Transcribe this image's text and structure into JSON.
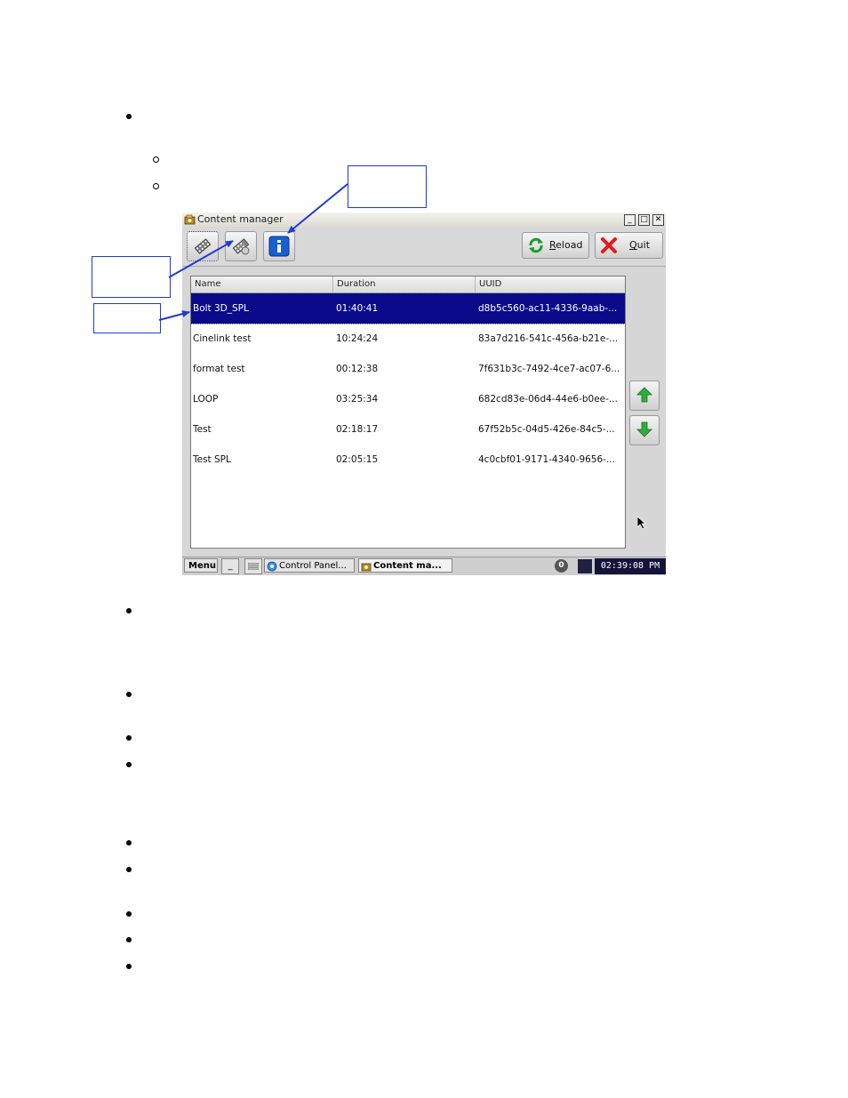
{
  "window": {
    "title": "Content manager",
    "minimize_glyph": "_",
    "maximize_glyph": "□",
    "close_glyph": "✕"
  },
  "toolbar": {
    "buttons": [
      {
        "icon": "ingest-film-icon",
        "active": true
      },
      {
        "icon": "delete-film-icon",
        "active": false
      },
      {
        "icon": "info-icon",
        "active": false
      }
    ],
    "reload_label": "Reload",
    "reload_mnemonic": "R",
    "reload_rest": "eload",
    "quit_label": "Quit",
    "quit_mnemonic": "Q",
    "quit_rest": "uit"
  },
  "table": {
    "columns": [
      "Name",
      "Duration",
      "UUID"
    ],
    "rows": [
      {
        "name": "Bolt 3D_SPL",
        "duration": "01:40:41",
        "uuid": "d8b5c560-ac11-4336-9aab-...",
        "selected": true
      },
      {
        "name": "Cinelink test",
        "duration": "10:24:24",
        "uuid": "83a7d216-541c-456a-b21e-...",
        "selected": false
      },
      {
        "name": "format test",
        "duration": "00:12:38",
        "uuid": "7f631b3c-7492-4ce7-ac07-6...",
        "selected": false
      },
      {
        "name": "LOOP",
        "duration": "03:25:34",
        "uuid": "682cd83e-06d4-44e6-b0ee-...",
        "selected": false
      },
      {
        "name": "Test",
        "duration": "02:18:17",
        "uuid": "67f52b5c-04d5-426e-84c5-...",
        "selected": false
      },
      {
        "name": "Test SPL",
        "duration": "02:05:15",
        "uuid": "4c0cbf01-9171-4340-9656-...",
        "selected": false
      }
    ]
  },
  "taskbar": {
    "menu_label": "Menu",
    "show_desktop_glyph": "_",
    "control_panel_label": "Control Panel...",
    "content_manager_label": "Content ma...",
    "notification_count": "0",
    "clock": "02:39:08 PM"
  },
  "colors": {
    "selection": "#0a0a8a",
    "callout_border": "#1f3bd1",
    "arrow": "#1f3bd1"
  }
}
